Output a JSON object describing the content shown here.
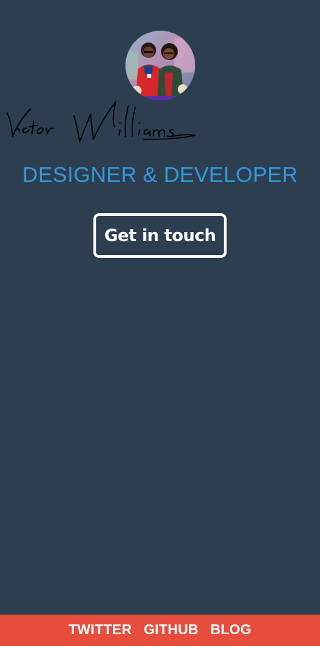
{
  "profile": {
    "name": "Victor Williams",
    "avatar_icon": "profile-photo",
    "tagline": "DESIGNER & DEVELOPER"
  },
  "cta": {
    "label": "Get in touch"
  },
  "footer": {
    "links": [
      {
        "label": "TWITTER"
      },
      {
        "label": "GITHUB"
      },
      {
        "label": "BLOG"
      }
    ]
  },
  "colors": {
    "background": "#2c3e50",
    "accent": "#3498db",
    "footer": "#e74c3c",
    "text": "#ffffff"
  }
}
